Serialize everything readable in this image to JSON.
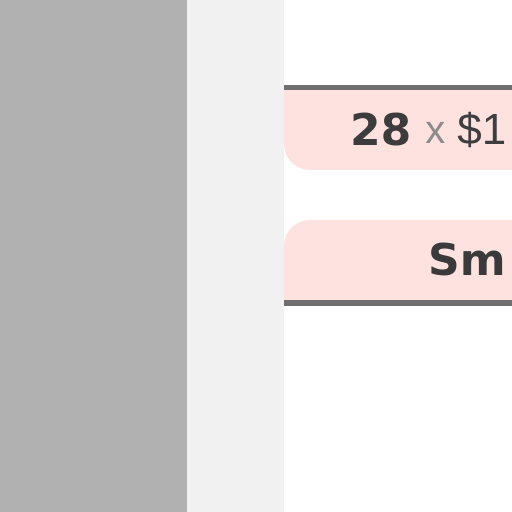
{
  "quantity_row": {
    "quantity": "28",
    "times": "x",
    "price": "$1"
  },
  "label_row": {
    "text": "Sm"
  },
  "colors": {
    "left_panel": "#b1b1b1",
    "gutter": "#f1f1f1",
    "row_background": "#fde2df",
    "rule": "#6f6f6f",
    "text": "#3e3e3e",
    "times_symbol": "#8c8c8c"
  }
}
